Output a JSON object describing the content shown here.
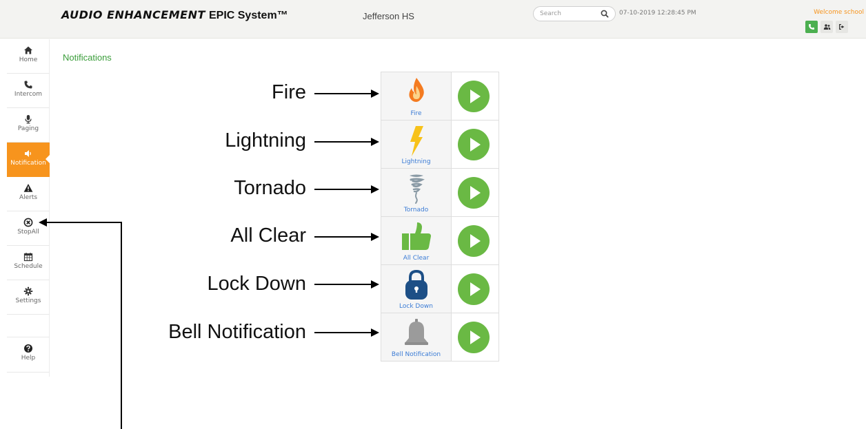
{
  "header": {
    "brand_bold": "AUDIO ENHANCEMENT",
    "brand_rest": "EPIC System™",
    "school": "Jefferson HS",
    "search_placeholder": "Search",
    "datetime": "07-10-2019 12:28:45 PM",
    "welcome": "Welcome school",
    "buttons": [
      {
        "icon": "phone-icon"
      },
      {
        "icon": "users-icon"
      },
      {
        "icon": "logout-icon"
      }
    ]
  },
  "sidebar": {
    "items": [
      {
        "label": "Home",
        "icon": "home-icon"
      },
      {
        "label": "Intercom",
        "icon": "phone-icon"
      },
      {
        "label": "Paging",
        "icon": "microphone-icon"
      },
      {
        "label": "Notification",
        "icon": "speaker-icon",
        "active": true
      },
      {
        "label": "Alerts",
        "icon": "warning-icon"
      },
      {
        "label": "StopAll",
        "icon": "stop-circle-icon"
      },
      {
        "label": "Schedule",
        "icon": "calendar-icon"
      },
      {
        "label": "Settings",
        "icon": "gear-icon"
      },
      {
        "label": "Help",
        "icon": "help-icon"
      }
    ]
  },
  "page": {
    "title": "Notifications"
  },
  "notifications": [
    {
      "label": "Fire",
      "icon": "fire-icon"
    },
    {
      "label": "Lightning",
      "icon": "lightning-icon"
    },
    {
      "label": "Tornado",
      "icon": "tornado-icon"
    },
    {
      "label": "All Clear",
      "icon": "thumbs-up-icon"
    },
    {
      "label": "Lock Down",
      "icon": "lock-icon"
    },
    {
      "label": "Bell Notification",
      "icon": "bell-icon"
    }
  ],
  "annotations": {
    "labels": [
      "Fire",
      "Lightning",
      "Tornado",
      "All Clear",
      "Lock Down",
      "Bell Notification"
    ]
  },
  "colors": {
    "accent_orange": "#f7941d",
    "accent_green": "#6ab944",
    "title_green": "#3a9d3a",
    "caption_blue": "#3a7bd5"
  }
}
